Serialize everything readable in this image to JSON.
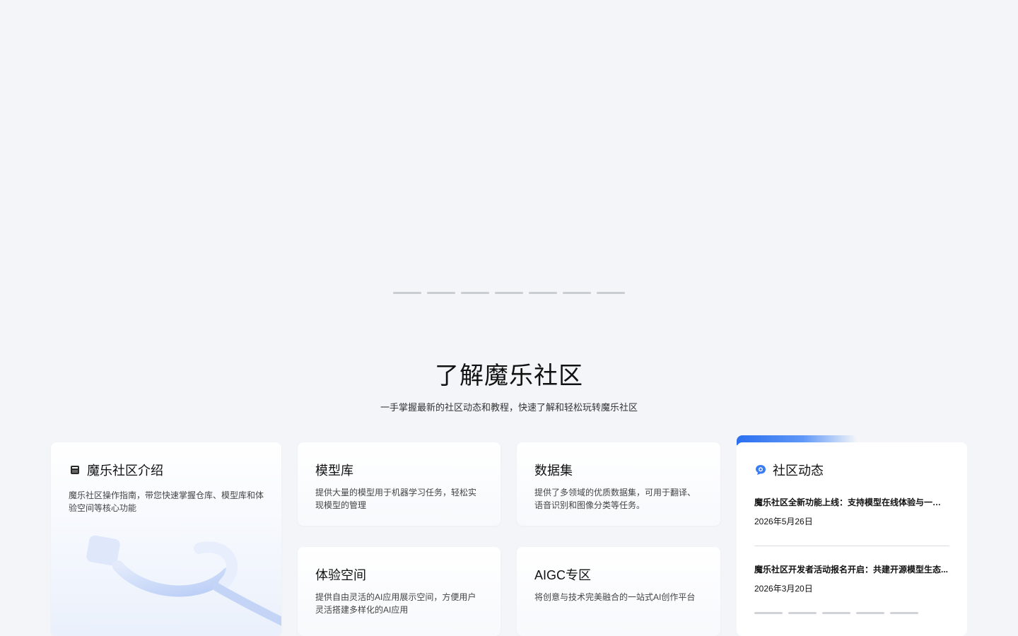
{
  "banner": {
    "indicator_count": 7
  },
  "section": {
    "title": "了解魔乐社区",
    "subtitle": "一手掌握最新的社区动态和教程，快速了解和轻松玩转魔乐社区"
  },
  "cards": {
    "intro": {
      "title": "魔乐社区介绍",
      "desc": "魔乐社区操作指南，带您快速掌握仓库、模型库和体验空间等核心功能"
    },
    "models": {
      "title": "模型库",
      "desc": "提供大量的模型用于机器学习任务，轻松实现模型的管理"
    },
    "datasets": {
      "title": "数据集",
      "desc": "提供了多领域的优质数据集，可用于翻译、语音识别和图像分类等任务。"
    },
    "spaces": {
      "title": "体验空间",
      "desc": "提供自由灵活的AI应用展示空间，方便用户灵活搭建多样化的AI应用"
    },
    "aigc": {
      "title": "AIGC专区",
      "desc": "将创意与技术完美融合的一站式AI创作平台"
    }
  },
  "news": {
    "title": "社区动态",
    "items": [
      {
        "text": "魔乐社区全新功能上线：支持模型在线体验与一键部署...",
        "date": "2026年5月26日"
      },
      {
        "text": "魔乐社区开发者活动报名开启：共建开源模型生态...",
        "date": "2026年3月20日"
      }
    ],
    "indicator_count": 5
  },
  "colors": {
    "accent": "#2b6ff0",
    "background": "#f3f5f8"
  }
}
